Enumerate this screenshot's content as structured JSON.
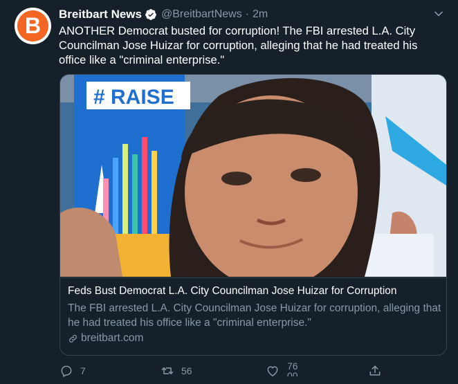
{
  "tweet": {
    "author_name": "Breitbart News",
    "author_handle": "@BreitbartNews",
    "separator": "·",
    "time": "2m",
    "avatar_letter": "B",
    "text": "ANOTHER Democrat busted for corruption! The FBI arrested L.A. City Councilman Jose Huizar for corruption, alleging that he had treated his office like a \"criminal enterprise.\""
  },
  "card": {
    "title": "Feds Bust Democrat L.A. City Councilman Jose Huizar for Corruption",
    "description": "The FBI arrested L.A. City Councilman Jose Huizar for corruption, alleging that he had treated his office like a \"criminal enterprise.\"",
    "domain": "breitbart.com",
    "photo_sign_text": "# RAISE"
  },
  "actions": {
    "replies": "7",
    "retweets": "56",
    "likes": "76",
    "likes_second_line": "00"
  },
  "colors": {
    "background": "#15202b",
    "text_primary": "#ffffff",
    "text_secondary": "#8899a6",
    "border": "#38444d",
    "brand_orange": "#f26522",
    "verified_blue": "#ffffff"
  },
  "icons": [
    "breitbart-logo",
    "verified-badge-icon",
    "chevron-down-icon",
    "link-icon",
    "reply-icon",
    "retweet-icon",
    "like-icon",
    "share-icon"
  ]
}
